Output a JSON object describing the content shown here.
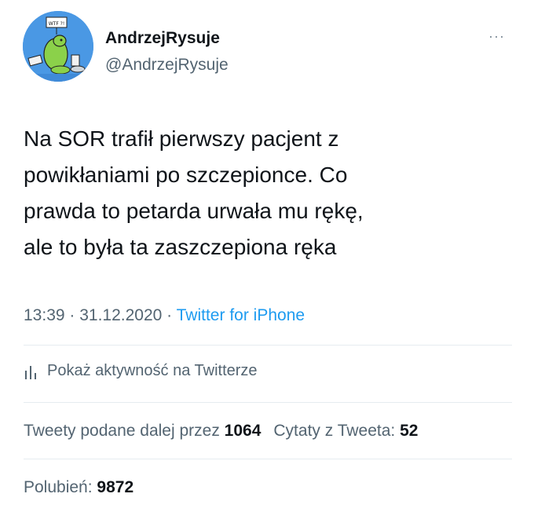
{
  "author": {
    "name": "AndrzejRysuje",
    "handle": "@AndrzejRysuje",
    "avatar_sign": "WTF ?!"
  },
  "more_label": "···",
  "tweet": {
    "text": "Na SOR trafił pierwszy pacjent z\npowikłaniami po szczepionce. Co\nprawda to petarda urwała mu rękę,\nale to była ta zaszczepiona ręka"
  },
  "meta": {
    "time": "13:39",
    "separator1": " · ",
    "date": "31.12.2020",
    "separator2": " · ",
    "source": "Twitter for iPhone"
  },
  "activity": {
    "icon": "bar-chart-icon",
    "label": "Pokaż aktywność na Twitterze"
  },
  "stats": {
    "retweets_label": "Tweety podane dalej przez ",
    "retweets_count": "1064",
    "quotes_label": "Cytaty z Tweeta: ",
    "quotes_count": "52"
  },
  "likes": {
    "label": "Polubień: ",
    "count": "9872"
  },
  "colors": {
    "text_primary": "#0f1419",
    "text_secondary": "#536471",
    "link": "#1d9bf0",
    "divider": "#e6ecf0",
    "avatar_bg": "#4a98e4"
  }
}
